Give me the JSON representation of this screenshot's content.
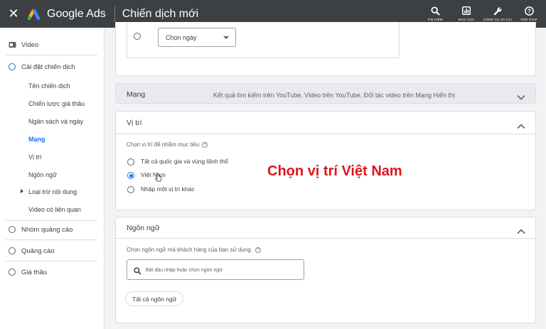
{
  "topbar": {
    "close_icon": "close-icon",
    "app_name": "Google Ads",
    "page_title": "Chiến dịch mới",
    "actions": [
      {
        "label": "TÌM KIẾM",
        "icon": "search-icon"
      },
      {
        "label": "BÁO CÁO",
        "icon": "reports-icon"
      },
      {
        "label": "CÔNG CỤ VÀ CÀI",
        "icon": "wrench-icon"
      },
      {
        "label": "TRỢ GIÚP",
        "icon": "help-icon"
      }
    ]
  },
  "sidebar": {
    "video": "Video",
    "campaign_settings": "Cài đặt chiến dịch",
    "sub_items": [
      "Tên chiến dịch",
      "Chiến lược giá thầu",
      "Ngân sách và ngày",
      "Mạng",
      "Vị trí",
      "Ngôn ngữ",
      "Loại trừ nội dung",
      "Video có liên quan"
    ],
    "active_sub_item": "Mạng",
    "ad_groups": "Nhóm quảng cáo",
    "ads": "Quảng cáo",
    "bids": "Giá thầu"
  },
  "dates_card": {
    "select_value": "Chọn ngày"
  },
  "network_card": {
    "title": "Mạng",
    "summary": "Kết quả tìm kiếm trên YouTube, Video trên YouTube, Đối tác video trên Mạng Hiển thị"
  },
  "location_card": {
    "title": "Vị trí",
    "help_label": "Chọn vị trí để nhắm mục tiêu",
    "options": [
      "Tất cả quốc gia và vùng lãnh thổ",
      "Việt Nam",
      "Nhập một vị trí khác"
    ],
    "selected_option": "Việt Nam"
  },
  "annotation_text": "Chọn vị trí Việt Nam",
  "language_card": {
    "title": "Ngôn ngữ",
    "help_label": "Chọn ngôn ngữ mà khách hàng của bạn sử dụng.",
    "search_placeholder": "Bắt đầu nhập hoặc chọn ngôn ngữ",
    "chip_label": "Tất cả ngôn ngữ"
  },
  "colors": {
    "topbar": "#3c4043",
    "accent": "#1a73e8",
    "annotation": "#e0141e"
  }
}
